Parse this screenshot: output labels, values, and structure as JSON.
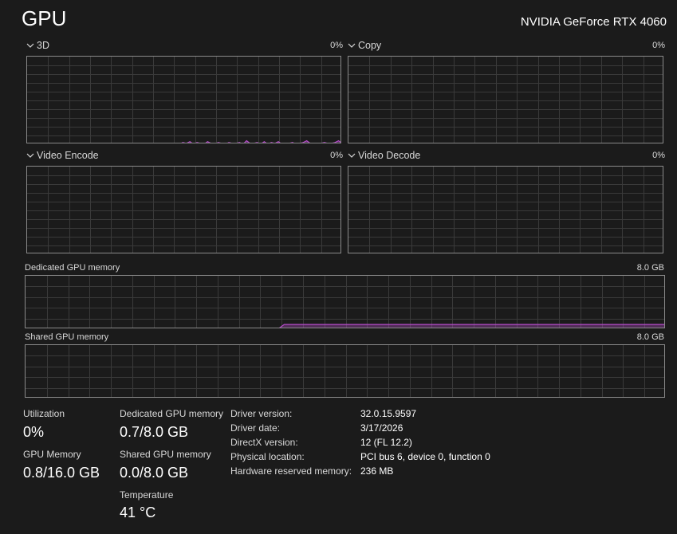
{
  "header": {
    "title": "GPU",
    "device_name": "NVIDIA GeForce RTX 4060"
  },
  "engines": [
    {
      "label": "3D",
      "percent": "0%"
    },
    {
      "label": "Copy",
      "percent": "0%"
    },
    {
      "label": "Video Encode",
      "percent": "0%"
    },
    {
      "label": "Video Decode",
      "percent": "0%"
    }
  ],
  "memory_graphs": {
    "dedicated": {
      "label": "Dedicated GPU memory",
      "max": "8.0 GB"
    },
    "shared": {
      "label": "Shared GPU memory",
      "max": "8.0 GB"
    }
  },
  "stats": {
    "utilization": {
      "label": "Utilization",
      "value": "0%"
    },
    "gpu_memory": {
      "label": "GPU Memory",
      "value": "0.8/16.0 GB"
    },
    "dedicated_memory": {
      "label": "Dedicated GPU memory",
      "value": "0.7/8.0 GB"
    },
    "shared_memory": {
      "label": "Shared GPU memory",
      "value": "0.0/8.0 GB"
    },
    "temperature": {
      "label": "Temperature",
      "value": "41 °C"
    }
  },
  "info": [
    {
      "key": "Driver version:",
      "value": "32.0.15.9597"
    },
    {
      "key": "Driver date:",
      "value": "3/17/2026"
    },
    {
      "key": "DirectX version:",
      "value": "12 (FL 12.2)"
    },
    {
      "key": "Physical location:",
      "value": "PCI bus 6, device 0, function 0"
    },
    {
      "key": "Hardware reserved memory:",
      "value": "236 MB"
    }
  ],
  "colors": {
    "accent": "#b44cc8",
    "grid": "#3a3a3a",
    "border": "#8a8a8a",
    "background": "#1b1b1b"
  },
  "chart_data": [
    {
      "type": "area",
      "series": [
        {
          "name": "3D",
          "values": [
            0,
            0,
            0,
            0,
            0,
            0,
            0,
            0,
            0,
            0,
            0,
            0,
            0,
            0,
            0,
            0,
            0,
            0,
            0,
            0,
            0,
            0,
            0,
            0,
            0,
            0,
            0,
            0,
            0,
            0,
            0,
            0,
            0,
            0,
            0,
            0,
            0,
            0,
            0,
            0,
            1,
            0,
            1,
            0,
            2,
            1,
            3,
            0,
            2,
            1,
            0,
            3,
            1,
            0,
            2,
            1,
            0,
            2,
            1,
            1,
            2,
            0,
            4,
            1,
            1,
            2,
            0,
            3,
            0,
            2,
            1,
            3,
            0,
            1,
            1,
            2,
            0,
            1,
            2,
            4,
            1,
            1,
            0,
            1,
            2,
            1,
            1,
            2,
            4,
            1
          ]
        }
      ],
      "ylim": [
        0,
        100
      ]
    },
    {
      "type": "area",
      "series": [
        {
          "name": "Dedicated GPU memory",
          "values": [
            0,
            0,
            0,
            0,
            0,
            0,
            0,
            0,
            0,
            0,
            0,
            0,
            0,
            0,
            0,
            0,
            0,
            0,
            0,
            0,
            0,
            0,
            0,
            0,
            0,
            0,
            0,
            0,
            0,
            0,
            0,
            0,
            0,
            0,
            0,
            0,
            0,
            0,
            0,
            0,
            0.7,
            0.7,
            0.7,
            0.7,
            0.7,
            0.7,
            0.7,
            0.7,
            0.7,
            0.7,
            0.7,
            0.7,
            0.7,
            0.7,
            0.7,
            0.7,
            0.7,
            0.7,
            0.7,
            0.7,
            0.7,
            0.7,
            0.7,
            0.7,
            0.7,
            0.7,
            0.7,
            0.7,
            0.7,
            0.7,
            0.7,
            0.7,
            0.7,
            0.7,
            0.7,
            0.7,
            0.7,
            0.7,
            0.7,
            0.7,
            0.7,
            0.7,
            0.7,
            0.7,
            0.7,
            0.7,
            0.7,
            0.7,
            0.7,
            0.7,
            0.7,
            0.7,
            0.7,
            0.7,
            0.7,
            0.7,
            0.7,
            0.7,
            0.7,
            0.7
          ]
        }
      ],
      "ylim": [
        0,
        8.0
      ]
    }
  ]
}
